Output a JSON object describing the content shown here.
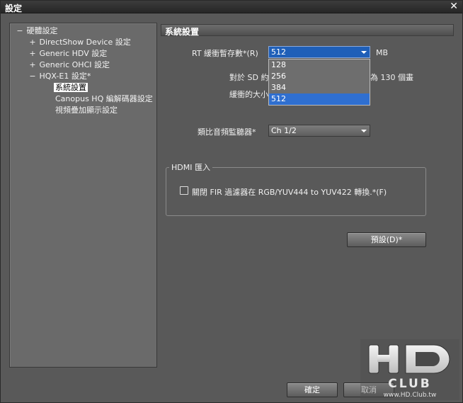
{
  "window": {
    "title": "設定",
    "close_glyph": "✕"
  },
  "tree": {
    "items": [
      {
        "expander": "−",
        "label": "硬體設定"
      },
      {
        "expander": "+",
        "label": "DirectShow Device 設定"
      },
      {
        "expander": "+",
        "label": "Generic HDV 設定"
      },
      {
        "expander": "+",
        "label": "Generic OHCI 設定"
      },
      {
        "expander": "−",
        "label": "HQX-E1 設定*"
      },
      {
        "expander": "",
        "label": "系統設置"
      },
      {
        "expander": "",
        "label": "Canopus HQ 編解碼器設定"
      },
      {
        "expander": "",
        "label": "視頻疊加顯示設定"
      }
    ]
  },
  "panel": {
    "header": "系統設置",
    "rt_buffer": {
      "label": "RT 緩衝暫存數*(R)",
      "value": "512",
      "unit": "MB",
      "options": [
        "128",
        "256",
        "384",
        "512"
      ],
      "selected_option": "512"
    },
    "info_line1_left": "對於 SD 約",
    "info_line1_right": "為 130 個畫",
    "info_line2": "緩衝的大小",
    "audio_monitor": {
      "label": "類比音頻監聽器*",
      "value": "Ch 1/2"
    },
    "hdmi": {
      "title": "HDMI 匯入",
      "fir_label": "關閉 FIR 過濾器在 RGB/YUV444 to YUV422 轉換.*(F)",
      "fir_checked": false
    },
    "default_button": "預設(D)*"
  },
  "footer": {
    "ok_button": "確定",
    "cancel_button": "取消"
  },
  "watermark": {
    "logo": "HD CLUB",
    "url": "www.HD.Club.tw"
  }
}
